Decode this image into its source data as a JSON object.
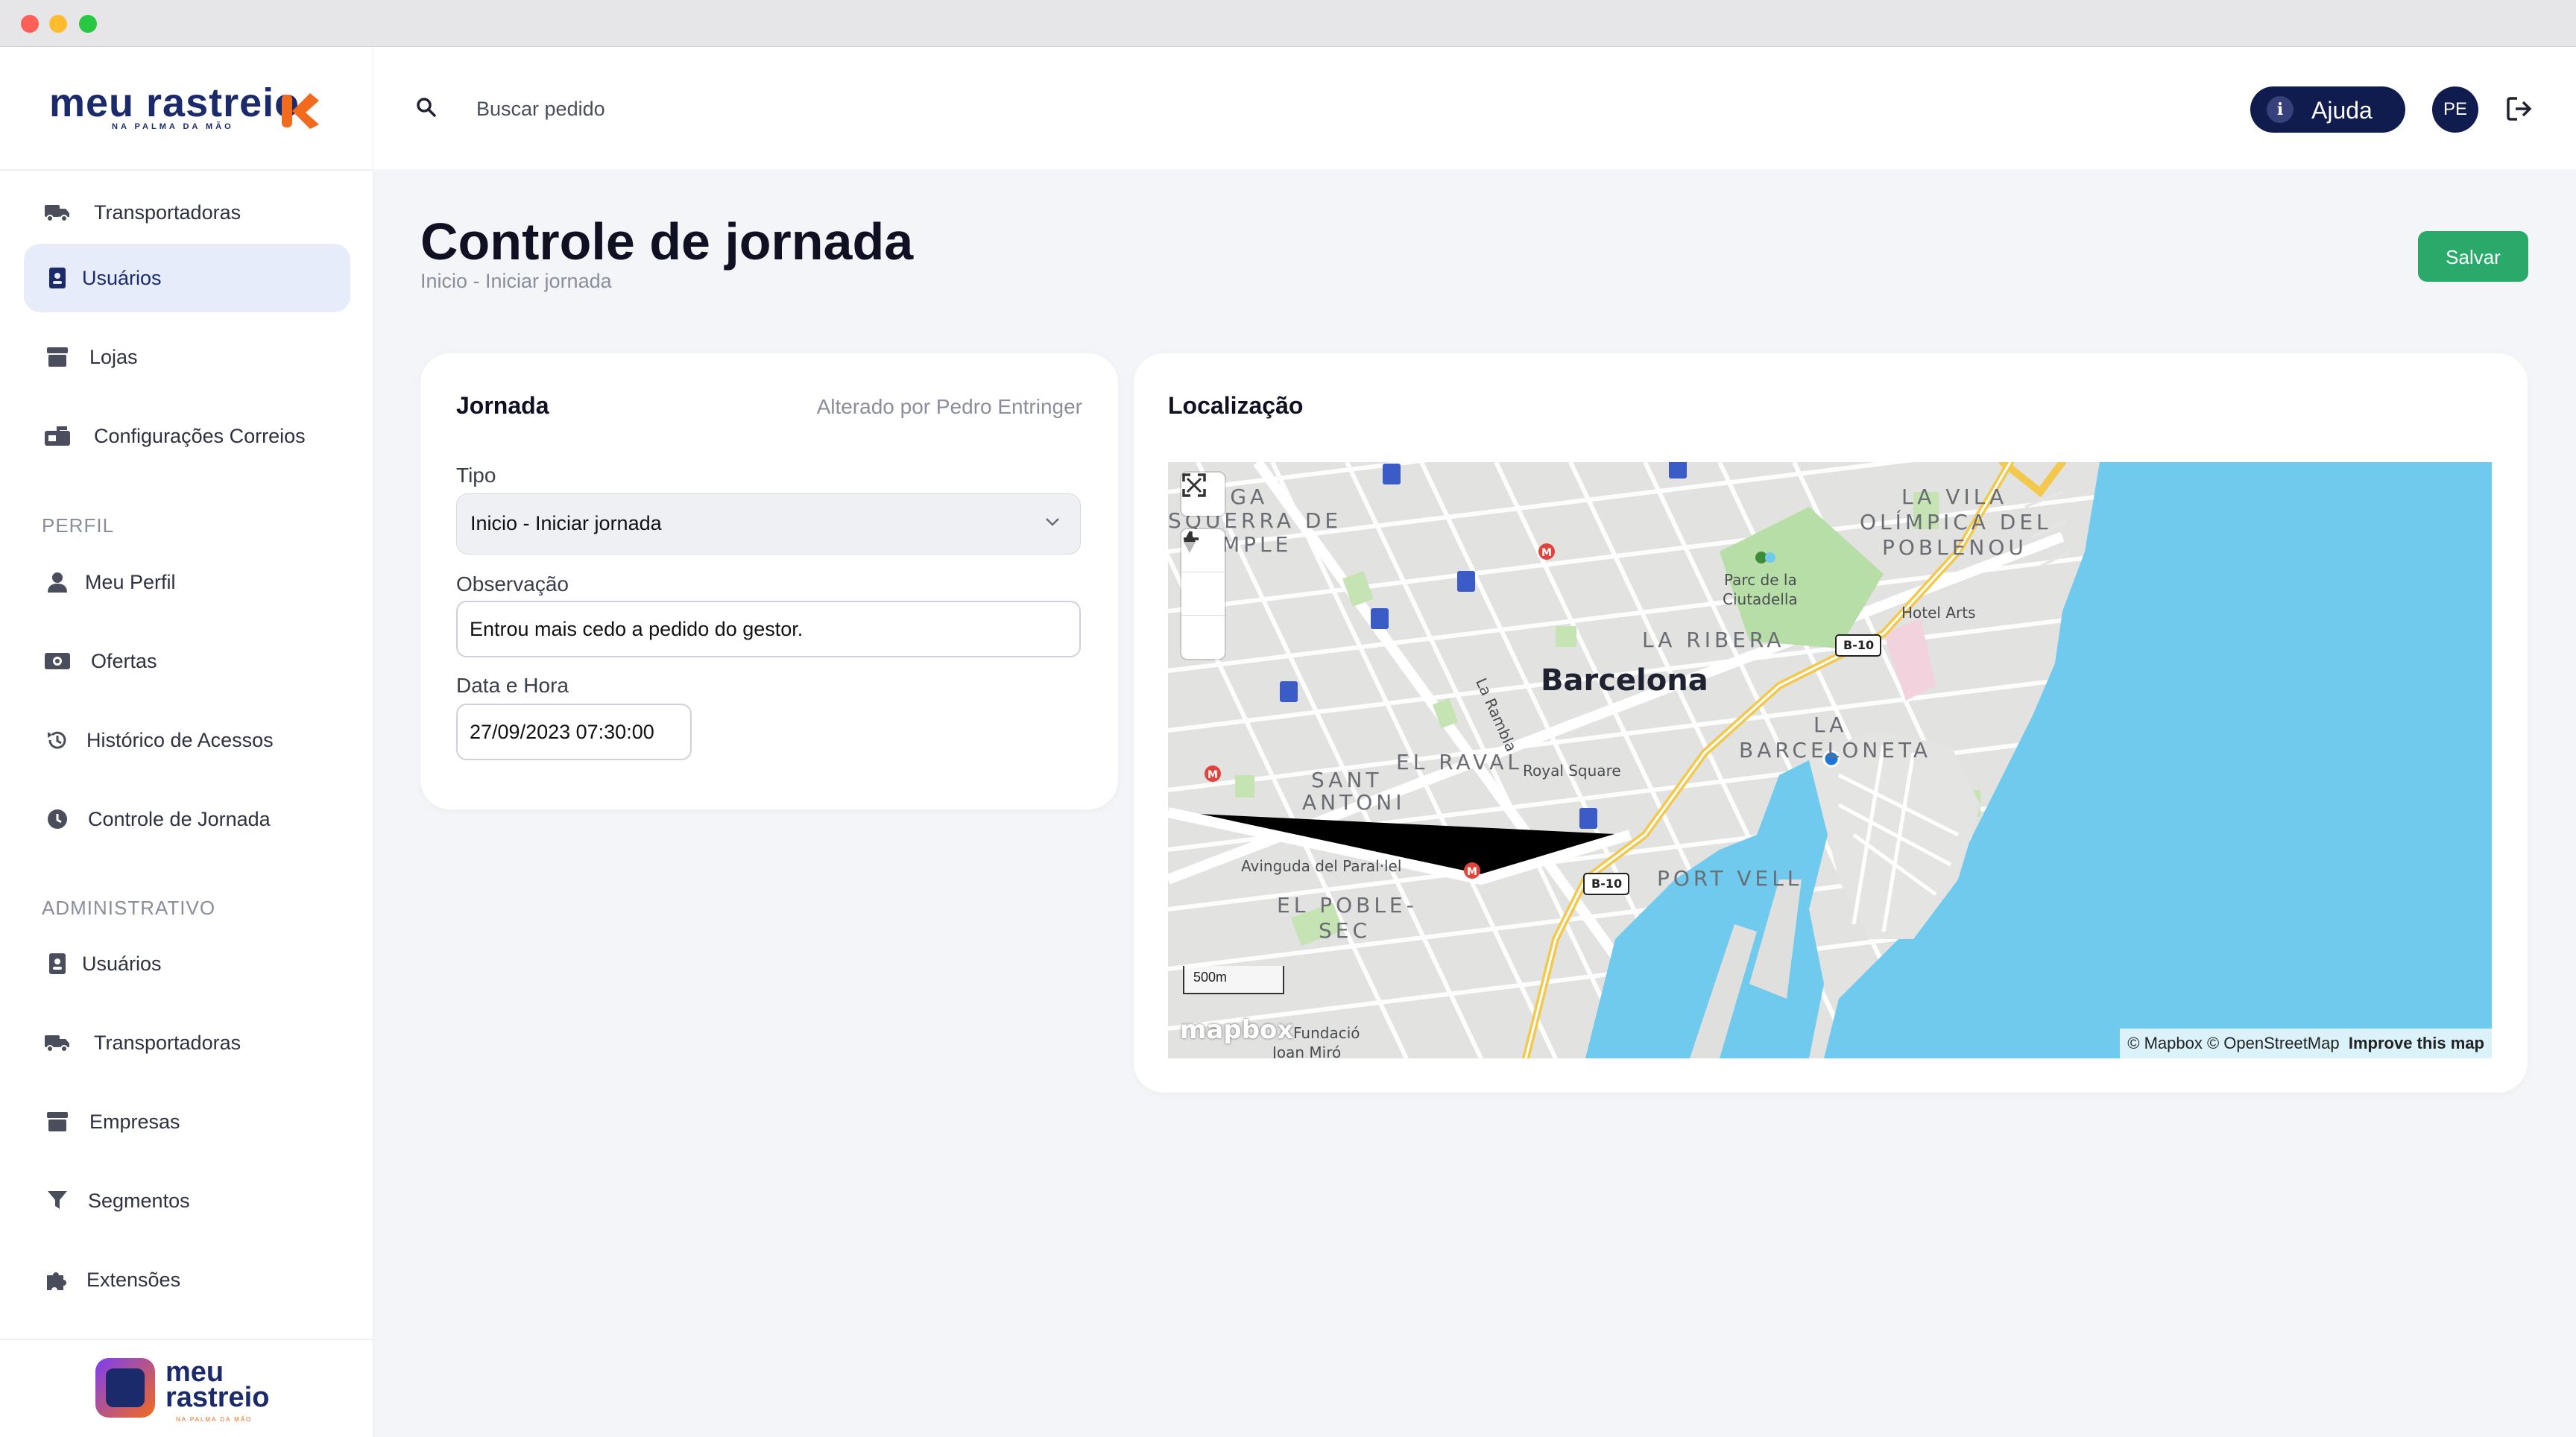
{
  "brand": {
    "name": "meu rastreio",
    "tagline": "NA PALMA DA MÃO"
  },
  "sidebar": {
    "items_top": [
      {
        "label": "Transportadoras",
        "icon": "truck-icon"
      },
      {
        "label": "Usuários",
        "icon": "badge-icon",
        "active": true
      },
      {
        "label": "Lojas",
        "icon": "store-icon"
      },
      {
        "label": "Configurações Correios",
        "icon": "mailbox-icon"
      }
    ],
    "section_perfil": "PERFIL",
    "items_perfil": [
      {
        "label": "Meu Perfil",
        "icon": "user-icon"
      },
      {
        "label": "Ofertas",
        "icon": "money-icon"
      },
      {
        "label": "Histórico de Acessos",
        "icon": "history-icon"
      },
      {
        "label": "Controle de Jornada",
        "icon": "clock-icon"
      }
    ],
    "section_admin": "ADMINISTRATIVO",
    "items_admin": [
      {
        "label": "Usuários",
        "icon": "badge-icon"
      },
      {
        "label": "Transportadoras",
        "icon": "truck-icon"
      },
      {
        "label": "Empresas",
        "icon": "store-icon"
      },
      {
        "label": "Segmentos",
        "icon": "filter-icon"
      },
      {
        "label": "Extensões",
        "icon": "puzzle-icon"
      }
    ],
    "footer": {
      "line1": "meu",
      "line2": "rastreio",
      "tagline": "NA PALMA DA MÃO"
    }
  },
  "header": {
    "search_placeholder": "Buscar pedido",
    "help_label": "Ajuda",
    "help_icon": "i",
    "avatar_initials": "PE"
  },
  "page": {
    "title": "Controle de jornada",
    "breadcrumb": "Inicio - Iniciar jornada",
    "save_label": "Salvar"
  },
  "jornada": {
    "title": "Jornada",
    "altered_by": "Alterado por Pedro Entringer",
    "tipo_label": "Tipo",
    "tipo_value": "Inicio - Iniciar jornada",
    "obs_label": "Observação",
    "obs_value": "Entrou mais cedo a pedido do gestor.",
    "datetime_label": "Data e Hora",
    "datetime_value": "27/09/2023 07:30:00"
  },
  "location": {
    "title": "Localização",
    "map": {
      "city": "Barcelona",
      "districts": [
        "LA VILA",
        "OLÍMPICA DEL",
        "POBLENOU",
        "LA RIBERA",
        "EL RAVAL",
        "SANT",
        "ANTONI",
        "LA",
        "BARCELONETA",
        "EL POBLE-",
        "SEC",
        "PORT VELL",
        "TIGA",
        "SQUERRA DE",
        "MPLE"
      ],
      "places": [
        "Parc de la",
        "Ciutadella",
        "Hotel Arts",
        "La Rambla",
        "Royal Square",
        "Avinguda del Paral·lel",
        "Fundació",
        "Joan Miró"
      ],
      "road_shields": [
        "B-10",
        "B-10"
      ],
      "scale": "500m",
      "logo": "mapbox",
      "attribution": "© Mapbox © OpenStreetMap",
      "improve": "Improve this map"
    }
  },
  "colors": {
    "primary_navy": "#101b4e",
    "save_green": "#2aa96b",
    "water": "#6fcaed",
    "park": "#b7dfa6"
  }
}
